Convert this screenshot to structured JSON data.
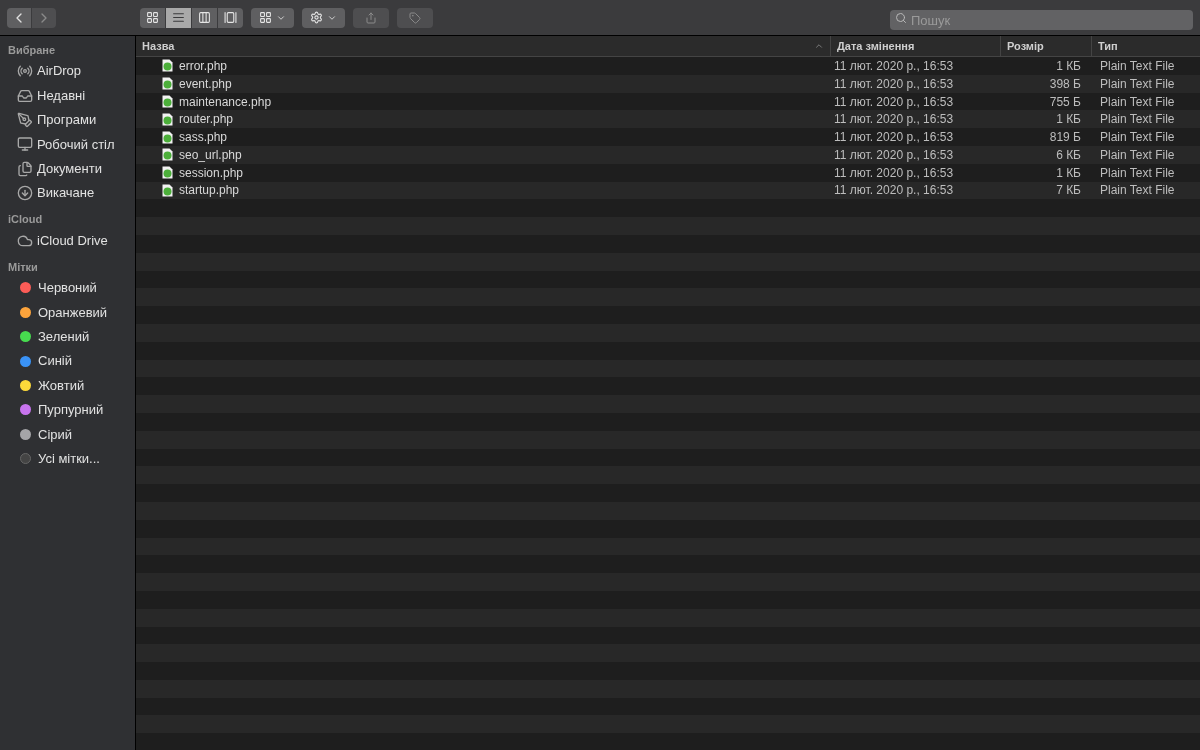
{
  "toolbar": {
    "views": [
      {
        "kind": "icons",
        "selected": false
      },
      {
        "kind": "list",
        "selected": true
      },
      {
        "kind": "columns",
        "selected": false
      },
      {
        "kind": "gallery",
        "selected": false
      }
    ],
    "search": {
      "placeholder": "Пошук"
    }
  },
  "sidebar": {
    "sections": [
      {
        "title": "Вибране",
        "items": [
          {
            "label": "AirDrop"
          },
          {
            "label": "Недавні"
          },
          {
            "label": "Програми"
          },
          {
            "label": "Робочий стіл"
          },
          {
            "label": "Документи"
          },
          {
            "label": "Викачане"
          }
        ]
      },
      {
        "title": "iCloud",
        "items": [
          {
            "label": "iCloud Drive"
          }
        ]
      }
    ],
    "tags": {
      "title": "Мітки",
      "items": [
        {
          "kind": "color",
          "label": "Червоний",
          "color": "#fc5c57"
        },
        {
          "kind": "color",
          "label": "Оранжевий",
          "color": "#fda43c"
        },
        {
          "kind": "color",
          "label": "Зелений",
          "color": "#47dc4f"
        },
        {
          "kind": "color",
          "label": "Синій",
          "color": "#3a93f7"
        },
        {
          "kind": "color",
          "label": "Жовтий",
          "color": "#fcd93a"
        },
        {
          "kind": "color",
          "label": "Пурпурний",
          "color": "#c874ee"
        },
        {
          "kind": "color",
          "label": "Сірий",
          "color": "#a5a5a8"
        },
        {
          "kind": "all",
          "label": "Усі мітки..."
        }
      ]
    }
  },
  "table": {
    "columns": [
      {
        "label": "Назва",
        "sorted": true
      },
      {
        "label": "Дата змінення",
        "sorted": false
      },
      {
        "label": "Розмір",
        "sorted": false
      },
      {
        "label": "Тип",
        "sorted": false
      }
    ],
    "rows": [
      {
        "name": "error.php",
        "date": "11 лют. 2020 р., 16:53",
        "size": "1 КБ",
        "type": "Plain Text File"
      },
      {
        "name": "event.php",
        "date": "11 лют. 2020 р., 16:53",
        "size": "398 Б",
        "type": "Plain Text File"
      },
      {
        "name": "maintenance.php",
        "date": "11 лют. 2020 р., 16:53",
        "size": "755 Б",
        "type": "Plain Text File"
      },
      {
        "name": "router.php",
        "date": "11 лют. 2020 р., 16:53",
        "size": "1 КБ",
        "type": "Plain Text File"
      },
      {
        "name": "sass.php",
        "date": "11 лют. 2020 р., 16:53",
        "size": "819 Б",
        "type": "Plain Text File"
      },
      {
        "name": "seo_url.php",
        "date": "11 лют. 2020 р., 16:53",
        "size": "6 КБ",
        "type": "Plain Text File"
      },
      {
        "name": "session.php",
        "date": "11 лют. 2020 р., 16:53",
        "size": "1 КБ",
        "type": "Plain Text File"
      },
      {
        "name": "startup.php",
        "date": "11 лют. 2020 р., 16:53",
        "size": "7 КБ",
        "type": "Plain Text File"
      }
    ]
  }
}
